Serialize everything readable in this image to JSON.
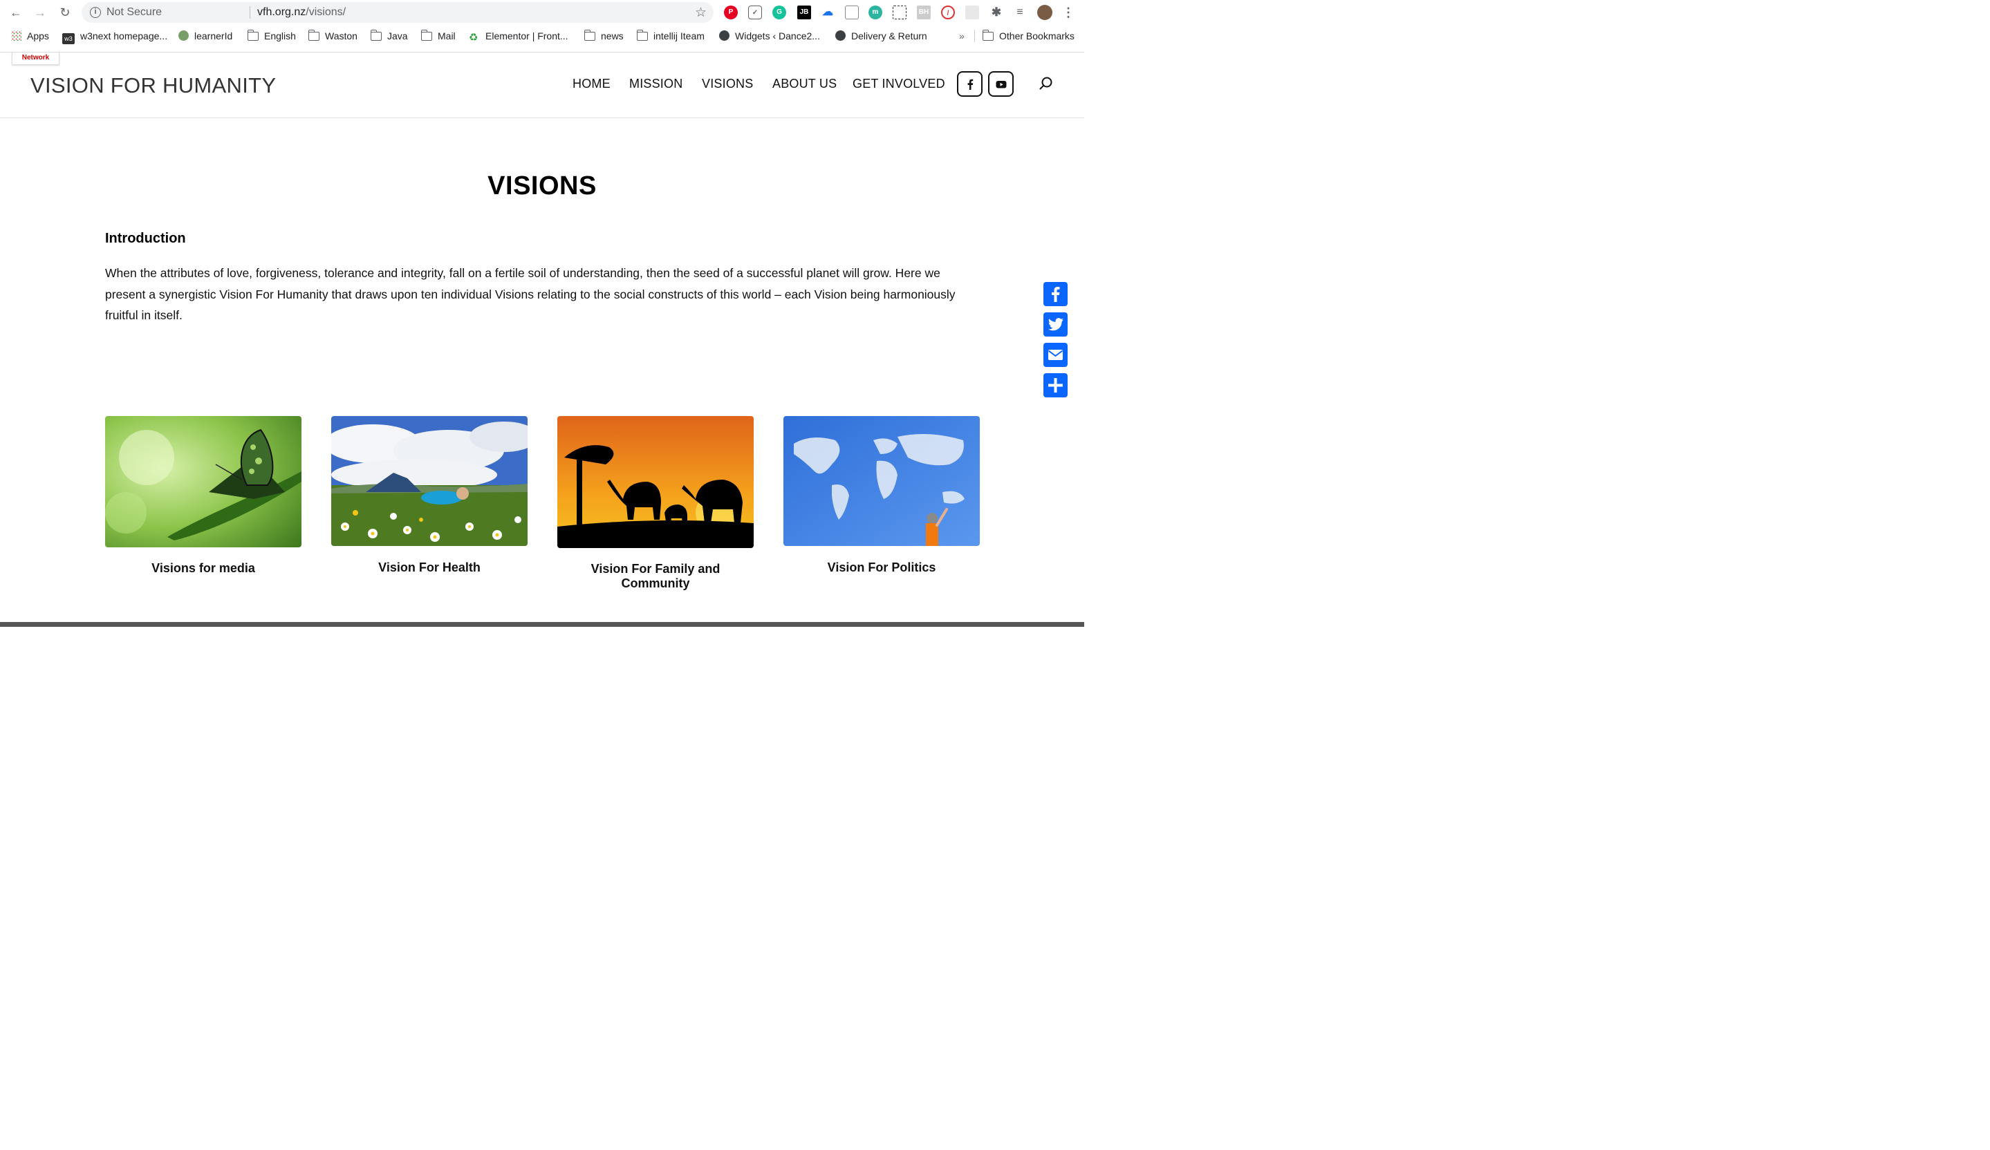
{
  "browser": {
    "security_label": "Not Secure",
    "url_host": "vfh.org.nz",
    "url_path": "/visions/",
    "bookmarks": [
      {
        "label": "Apps",
        "icon": "apps-grid-icon"
      },
      {
        "label": "w3next homepage...",
        "icon": "w3-icon"
      },
      {
        "label": "learnerId",
        "icon": "globe-icon"
      },
      {
        "label": "English",
        "icon": "folder-icon"
      },
      {
        "label": "Waston",
        "icon": "folder-icon"
      },
      {
        "label": "Java",
        "icon": "folder-icon"
      },
      {
        "label": "Mail",
        "icon": "folder-icon"
      },
      {
        "label": "Elementor | Front...",
        "icon": "recycle-icon"
      },
      {
        "label": "news",
        "icon": "folder-icon"
      },
      {
        "label": "intellij Iteam",
        "icon": "folder-icon"
      },
      {
        "label": "Widgets ‹ Dance2...",
        "icon": "globe-icon"
      },
      {
        "label": "Delivery & Return",
        "icon": "globe-icon"
      }
    ],
    "overflow_label": "»",
    "other_bookmarks": "Other Bookmarks"
  },
  "site": {
    "network_tab": "Network",
    "logo": "VISION FOR HUMANITY",
    "nav": [
      "HOME",
      "MISSION",
      "VISIONS",
      "ABOUT US",
      "GET INVOLVED"
    ]
  },
  "main": {
    "title": "VISIONS",
    "intro_heading": "Introduction",
    "intro_text": "When the attributes of love, forgiveness, tolerance and integrity, fall on a fertile soil of understanding, then the seed of a successful planet will grow. Here we present a synergistic Vision For Humanity that draws upon ten individual Visions relating to the social constructs of this world – each Vision being harmoniously fruitful in itself.",
    "cards": [
      {
        "label": "Visions for media"
      },
      {
        "label": "Vision For Health"
      },
      {
        "label": "Vision For Family and Community"
      },
      {
        "label": "Vision For Politics"
      }
    ]
  },
  "colors": {
    "share_blue": "#0a66ff",
    "network_red": "#cc0000"
  }
}
